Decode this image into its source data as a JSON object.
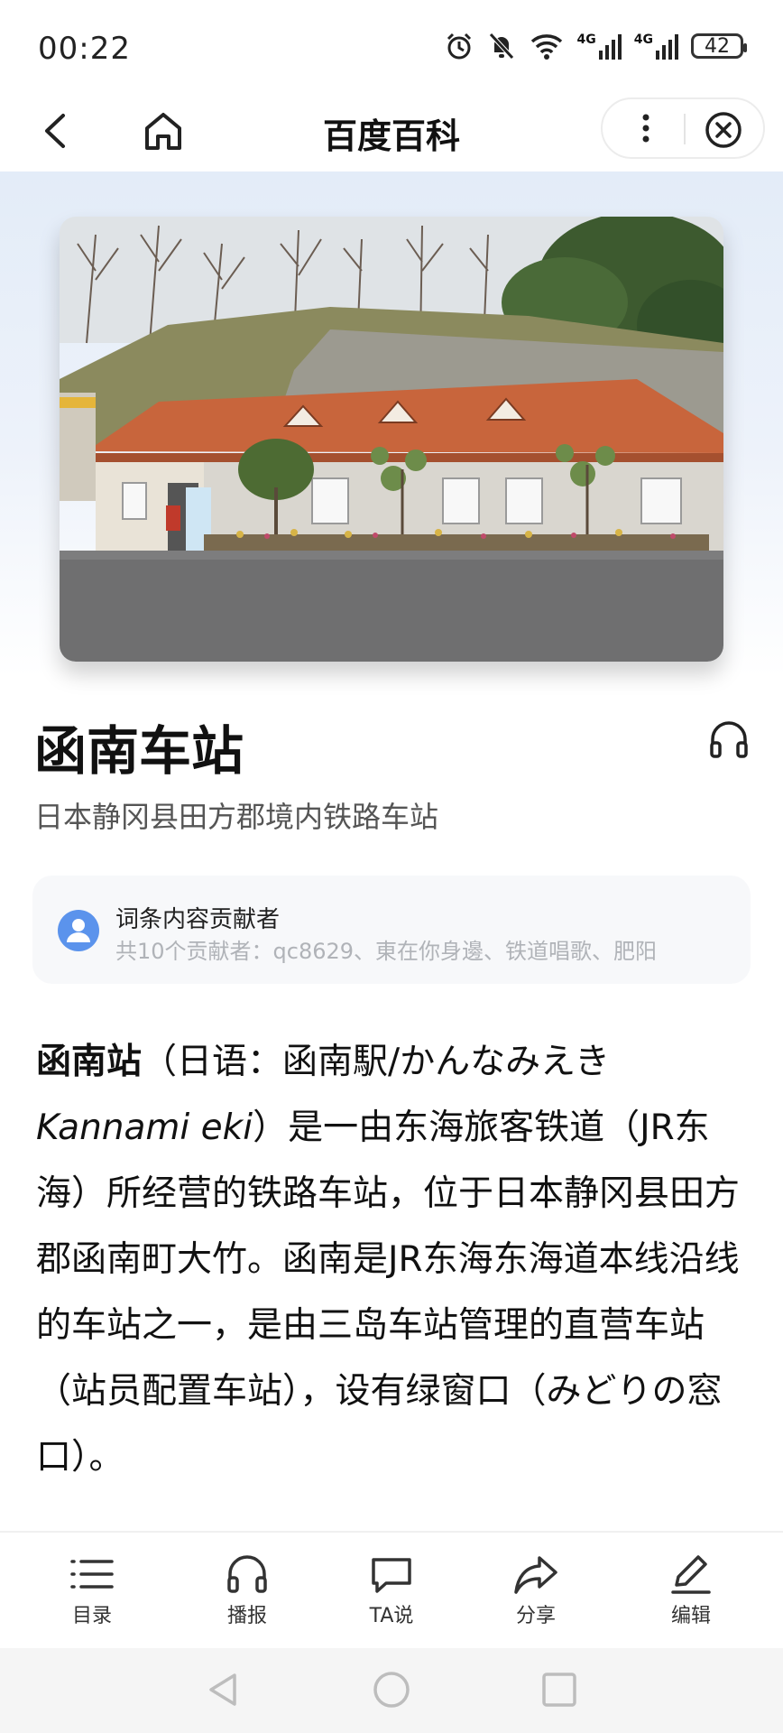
{
  "status_bar": {
    "time": "00:22",
    "network_1": "4G",
    "network_2": "4G",
    "battery": "42"
  },
  "nav": {
    "title": "百度百科"
  },
  "entry": {
    "title": "函南车站",
    "subtitle": "日本静冈县田方郡境内铁路车站"
  },
  "contributors": {
    "heading": "词条内容贡献者",
    "list": "共10个贡献者：qc8629、東在你身邊、铁道唱歌、肥阳"
  },
  "article": {
    "term": "函南站",
    "open_paren": "（日语：函南駅/かんなみえき ",
    "romaji": "Kannami eki",
    "body": "）是一由东海旅客铁道（JR东海）所经营的铁路车站，位于日本静冈县田方郡函南町大竹。函南是JR东海东海道本线沿线的车站之一，是由三岛车站管理的直营车站（站员配置车站），设有绿窗口（みどりの窓口）。"
  },
  "toolbar": {
    "items": [
      {
        "label": "目录",
        "icon": "list-icon"
      },
      {
        "label": "播报",
        "icon": "headphones-icon"
      },
      {
        "label": "TA说",
        "icon": "comment-icon"
      },
      {
        "label": "分享",
        "icon": "share-icon"
      },
      {
        "label": "编辑",
        "icon": "edit-icon"
      }
    ]
  },
  "colors": {
    "accent": "#5b93ec",
    "hero_gradient_top": "#e3ecf8",
    "roof": "#c8653c"
  }
}
